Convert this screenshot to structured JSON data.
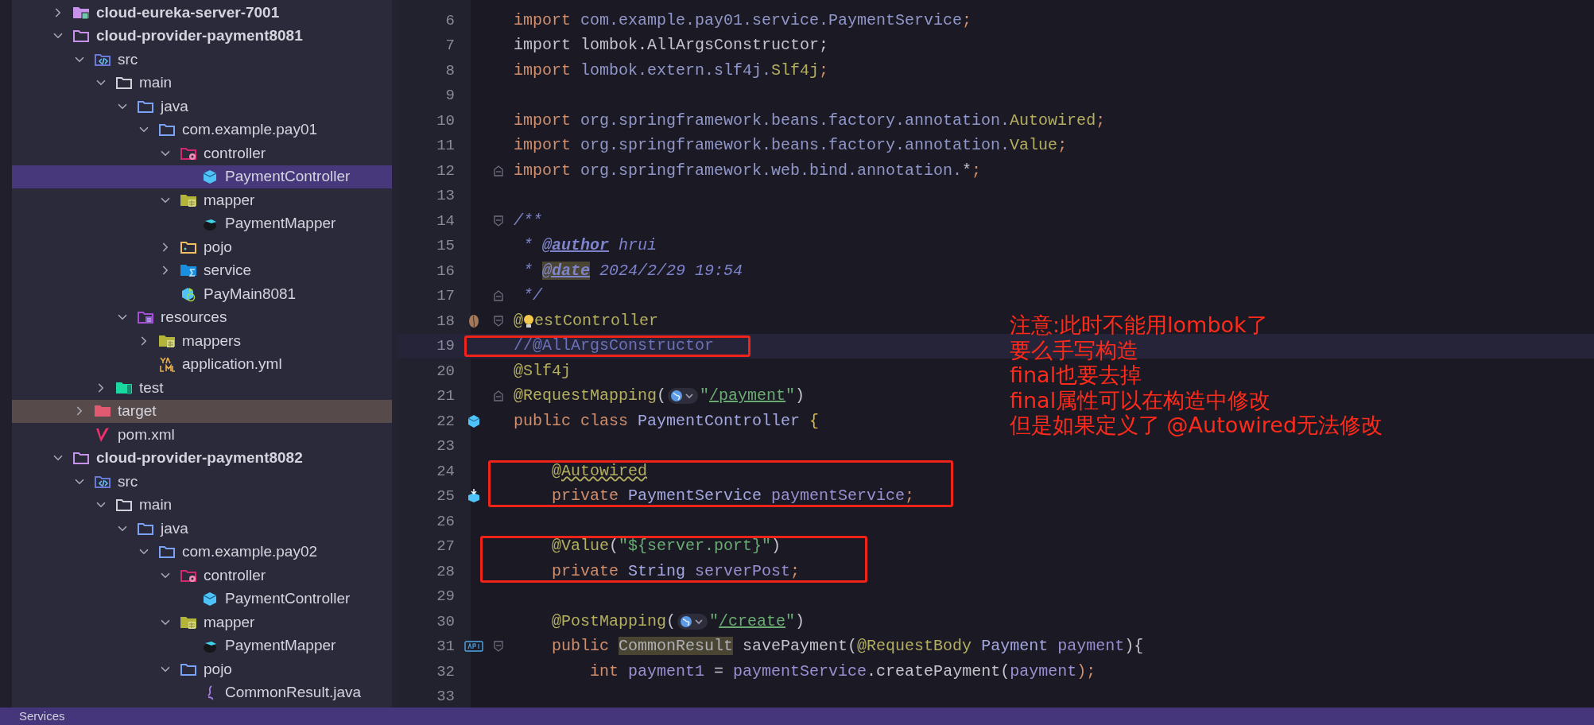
{
  "project_tree": [
    {
      "name": "cloud-eureka-server-7001",
      "kind": "module-eureka",
      "expanded": false,
      "selected": false
    },
    {
      "name": "cloud-provider-payment8081",
      "kind": "module",
      "expanded": true,
      "selected": false,
      "children": [
        {
          "name": "src",
          "kind": "src",
          "expanded": true,
          "selected": false,
          "children": [
            {
              "name": "main",
              "kind": "folder",
              "expanded": true,
              "selected": false,
              "children": [
                {
                  "name": "java",
                  "kind": "source-root",
                  "expanded": true,
                  "selected": false,
                  "children": [
                    {
                      "name": "com.example.pay01",
                      "kind": "source-root",
                      "expanded": true,
                      "selected": false,
                      "children": [
                        {
                          "name": "controller",
                          "kind": "controller",
                          "expanded": true,
                          "selected": false,
                          "children": [
                            {
                              "name": "PaymentController",
                              "kind": "class",
                              "selected": true
                            }
                          ]
                        },
                        {
                          "name": "mapper",
                          "kind": "mapper",
                          "expanded": true,
                          "selected": false,
                          "children": [
                            {
                              "name": "PaymentMapper",
                              "kind": "mybatis",
                              "selected": false
                            }
                          ]
                        },
                        {
                          "name": "pojo",
                          "kind": "pojo",
                          "expanded": false,
                          "selected": false
                        },
                        {
                          "name": "service",
                          "kind": "service",
                          "expanded": false,
                          "selected": false
                        },
                        {
                          "name": "PayMain8081",
                          "kind": "main-class",
                          "selected": false
                        }
                      ]
                    }
                  ]
                },
                {
                  "name": "resources",
                  "kind": "resources",
                  "expanded": true,
                  "selected": false,
                  "children": [
                    {
                      "name": "mappers",
                      "kind": "mapper",
                      "expanded": false,
                      "selected": false
                    },
                    {
                      "name": "application.yml",
                      "kind": "yml",
                      "selected": false
                    }
                  ]
                }
              ]
            },
            {
              "name": "test",
              "kind": "test",
              "expanded": false,
              "selected": false
            }
          ]
        },
        {
          "name": "target",
          "kind": "target",
          "expanded": false,
          "selected": false,
          "hovered": true
        },
        {
          "name": "pom.xml",
          "kind": "pom",
          "selected": false
        }
      ]
    },
    {
      "name": "cloud-provider-payment8082",
      "kind": "module",
      "expanded": true,
      "selected": false,
      "children": [
        {
          "name": "src",
          "kind": "src",
          "expanded": true,
          "selected": false,
          "children": [
            {
              "name": "main",
              "kind": "folder",
              "expanded": true,
              "selected": false,
              "children": [
                {
                  "name": "java",
                  "kind": "source-root",
                  "expanded": true,
                  "selected": false,
                  "children": [
                    {
                      "name": "com.example.pay02",
                      "kind": "source-root",
                      "expanded": true,
                      "selected": false,
                      "children": [
                        {
                          "name": "controller",
                          "kind": "controller",
                          "expanded": true,
                          "selected": false,
                          "children": [
                            {
                              "name": "PaymentController",
                              "kind": "class",
                              "selected": false
                            }
                          ]
                        },
                        {
                          "name": "mapper",
                          "kind": "mapper",
                          "expanded": true,
                          "selected": false,
                          "children": [
                            {
                              "name": "PaymentMapper",
                              "kind": "mybatis",
                              "selected": false
                            }
                          ]
                        },
                        {
                          "name": "pojo",
                          "kind": "folder-blue",
                          "expanded": true,
                          "selected": false,
                          "children": [
                            {
                              "name": "CommonResult.java",
                              "kind": "java-file",
                              "selected": false
                            }
                          ]
                        }
                      ]
                    }
                  ]
                }
              ]
            }
          ]
        }
      ]
    }
  ],
  "editor": {
    "blocks": [
      {
        "boxed": false,
        "lines": [
          {
            "number": "6",
            "tokens": [
              {
                "text": "import ",
                "kind": "kw"
              },
              {
                "text": "com.example.pay01.service.PaymentService",
                "kind": "pkg"
              },
              {
                "text": ";",
                "kind": "kw"
              }
            ]
          },
          {
            "number": "7",
            "tokens": [
              {
                "text": "import lombok.AllArgsConstructor;",
                "kind": "plain"
              }
            ]
          },
          {
            "number": "8",
            "tokens": [
              {
                "text": "import ",
                "kind": "kw"
              },
              {
                "text": "lombok.extern.slf4j.",
                "kind": "pkg"
              },
              {
                "text": "Slf4j",
                "kind": "ann"
              },
              {
                "text": ";",
                "kind": "kw"
              }
            ]
          },
          {
            "number": "9"
          },
          {
            "number": "10",
            "tokens": [
              {
                "text": "import ",
                "kind": "kw"
              },
              {
                "text": "org.springframework.beans.factory.annotation.",
                "kind": "pkg"
              },
              {
                "text": "Autowired",
                "kind": "ann"
              },
              {
                "text": ";",
                "kind": "kw"
              }
            ]
          },
          {
            "number": "11",
            "tokens": [
              {
                "text": "import ",
                "kind": "kw"
              },
              {
                "text": "org.springframework.beans.factory.annotation.",
                "kind": "pkg"
              },
              {
                "text": "Value",
                "kind": "ann"
              },
              {
                "text": ";",
                "kind": "kw"
              }
            ]
          },
          {
            "number": "12",
            "fold": {
              "kind": "end"
            },
            "tokens": [
              {
                "text": "import ",
                "kind": "kw"
              },
              {
                "text": "org.springframework.web.bind.annotation.",
                "kind": "pkg"
              },
              {
                "text": "*",
                "kind": "plain"
              },
              {
                "text": ";",
                "kind": "kw"
              }
            ]
          },
          {
            "number": "13"
          },
          {
            "number": "14",
            "fold": {
              "kind": "start"
            },
            "tokens": [
              {
                "text": "/**",
                "kind": "doc"
              }
            ]
          },
          {
            "number": "15",
            "tokens": [
              {
                "text": " * ",
                "kind": "doc"
              },
              {
                "text": "@author",
                "kind": "doctag"
              },
              {
                "text": " hrui",
                "kind": "doc"
              }
            ]
          },
          {
            "number": "16",
            "tokens": [
              {
                "text": " * ",
                "kind": "doc"
              },
              {
                "text": "@date",
                "kind": "doctag-marked"
              },
              {
                "text": " 2024/2/29 19:54",
                "kind": "doc"
              }
            ]
          },
          {
            "number": "17",
            "fold": {
              "kind": "end"
            },
            "tokens": [
              {
                "text": " */",
                "kind": "doc"
              }
            ]
          },
          {
            "number": "18",
            "fold": {
              "kind": "start"
            },
            "gutter": {
              "kind": "bean"
            },
            "tokens": [
              {
                "text": "@",
                "kind": "ann"
              },
              {
                "kind": "bulb"
              },
              {
                "text": "estController",
                "kind": "ann"
              }
            ]
          }
        ]
      },
      {
        "boxed": true,
        "lines": [
          {
            "number": "19",
            "current": true,
            "tokens": [
              {
                "text": "//@AllArgsConstructor",
                "kind": "comment"
              }
            ]
          }
        ]
      },
      {
        "boxed": false,
        "lines": [
          {
            "number": "20",
            "tokens": [
              {
                "text": "@Slf4j",
                "kind": "ann"
              }
            ]
          },
          {
            "number": "21",
            "fold": {
              "kind": "end"
            },
            "tokens": [
              {
                "text": "@RequestMapping",
                "kind": "ann"
              },
              {
                "text": "(",
                "kind": "plain"
              },
              {
                "kind": "globe"
              },
              {
                "text": "\"",
                "kind": "str"
              },
              {
                "text": "/payment",
                "kind": "link"
              },
              {
                "text": "\"",
                "kind": "str"
              },
              {
                "text": ")",
                "kind": "plain"
              }
            ]
          },
          {
            "number": "22",
            "gutter": {
              "kind": "cube"
            },
            "tokens": [
              {
                "text": "public class ",
                "kind": "kw"
              },
              {
                "text": "PaymentController ",
                "kind": "cls"
              },
              {
                "text": "{",
                "kind": "brace"
              }
            ]
          },
          {
            "number": "23"
          }
        ]
      },
      {
        "boxed": true,
        "lines": [
          {
            "number": "24",
            "tokens": [
              {
                "text": "    @Autowired",
                "kind": "squiggle"
              }
            ]
          },
          {
            "number": "25",
            "gutter": {
              "kind": "cube-arrow"
            },
            "tokens": [
              {
                "text": "    private ",
                "kind": "kw"
              },
              {
                "text": "PaymentService ",
                "kind": "cls"
              },
              {
                "text": "paymentService",
                "kind": "field"
              },
              {
                "text": ";",
                "kind": "kw"
              }
            ]
          }
        ]
      },
      {
        "boxed": false,
        "lines": [
          {
            "number": "26"
          }
        ]
      },
      {
        "boxed": true,
        "lines": [
          {
            "number": "27",
            "tokens": [
              {
                "text": "    @Value",
                "kind": "ann"
              },
              {
                "text": "(",
                "kind": "plain"
              },
              {
                "text": "\"${server.port}\"",
                "kind": "str"
              },
              {
                "text": ")",
                "kind": "plain"
              }
            ]
          },
          {
            "number": "28",
            "tokens": [
              {
                "text": "    private ",
                "kind": "kw"
              },
              {
                "text": "String ",
                "kind": "cls"
              },
              {
                "text": "serverPost",
                "kind": "field"
              },
              {
                "text": ";",
                "kind": "kw"
              }
            ]
          }
        ]
      },
      {
        "boxed": false,
        "lines": [
          {
            "number": "29"
          },
          {
            "number": "30",
            "tokens": [
              {
                "text": "    @PostMapping",
                "kind": "ann"
              },
              {
                "text": "(",
                "kind": "plain"
              },
              {
                "kind": "globe"
              },
              {
                "text": "\"",
                "kind": "str"
              },
              {
                "text": "/create",
                "kind": "link"
              },
              {
                "text": "\"",
                "kind": "str"
              },
              {
                "text": ")",
                "kind": "plain"
              }
            ]
          },
          {
            "number": "31",
            "fold": {
              "kind": "start"
            },
            "gutter": {
              "kind": "api"
            },
            "tokens": [
              {
                "text": "    public ",
                "kind": "kw"
              },
              {
                "text": "CommonResult",
                "kind": "marked"
              },
              {
                "text": " savePayment(",
                "kind": "plain"
              },
              {
                "text": "@RequestBody ",
                "kind": "ann"
              },
              {
                "text": "Payment ",
                "kind": "cls"
              },
              {
                "text": "payment",
                "kind": "field"
              },
              {
                "text": "){",
                "kind": "plain"
              }
            ]
          },
          {
            "number": "32",
            "tokens": [
              {
                "text": "        int ",
                "kind": "kw"
              },
              {
                "text": "payment1 ",
                "kind": "field"
              },
              {
                "text": "= ",
                "kind": "plain"
              },
              {
                "text": "paymentService",
                "kind": "field"
              },
              {
                "text": ".createPayment(",
                "kind": "plain"
              },
              {
                "text": "payment",
                "kind": "field"
              },
              {
                "text": ");",
                "kind": "kw"
              }
            ]
          },
          {
            "number": "33"
          }
        ]
      }
    ]
  },
  "note": [
    "注意:此时不能用lombok了",
    "要么手写构造",
    "final也要去掉",
    "final属性可以在构造中修改",
    "但是如果定义了  @Autowired无法修改"
  ],
  "status_bar": {
    "tool_window": "Services"
  }
}
